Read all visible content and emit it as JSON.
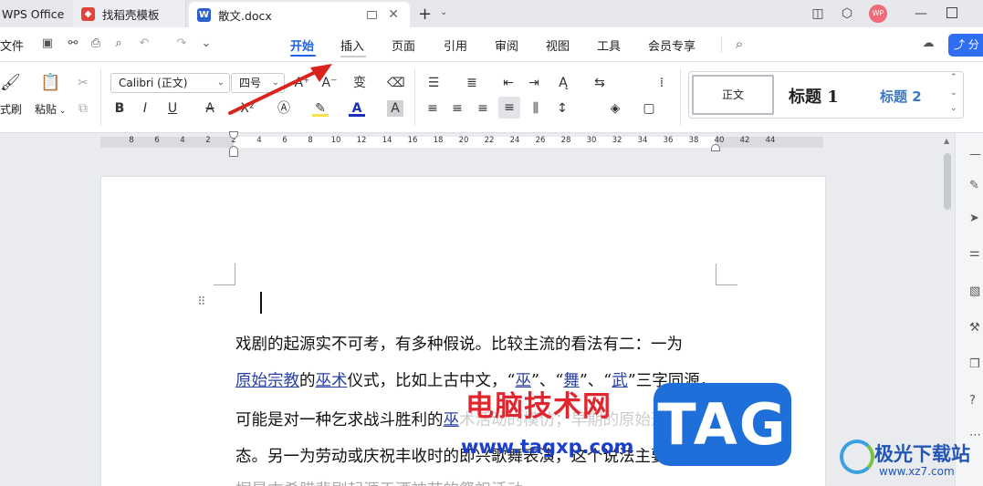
{
  "tabs": {
    "app": "WPS Office",
    "template": "找稻壳模板",
    "doc": "散文.docx"
  },
  "window": {
    "avatar": "WP"
  },
  "menu": {
    "file": "文件",
    "items": [
      "开始",
      "插入",
      "页面",
      "引用",
      "审阅",
      "视图",
      "工具",
      "会员专享"
    ],
    "share": "分"
  },
  "ribbon": {
    "format_painter": "式刷",
    "paste": "粘贴",
    "font_name": "Calibri (正文)",
    "font_size": "四号",
    "styles": {
      "normal": "正文",
      "h1": "标题 1",
      "h2": "标题 2"
    }
  },
  "ruler": {
    "ticks": [
      "8",
      "6",
      "4",
      "2",
      "2",
      "4",
      "6",
      "8",
      "10",
      "12",
      "14",
      "16",
      "18",
      "20",
      "22",
      "24",
      "26",
      "28",
      "30",
      "32",
      "34",
      "36",
      "38",
      "40",
      "42",
      "44"
    ]
  },
  "document": {
    "line1": "戏剧的起源实不可考，有多种假说。比较主流的看法有二：一为",
    "line2": {
      "l1": "原始宗教",
      "t1": "的",
      "l2": "巫术",
      "t2": "仪式，比如上古中文，“",
      "l3": "巫",
      "t3": "”、“",
      "l4": "舞",
      "t4": "”、“",
      "l5": "武",
      "t5": "”三字同源，"
    },
    "line3": {
      "t1": "可能是对一种乞求战斗胜利的",
      "l1": "巫",
      "t2": "术",
      "t3": "活动的模仿；早期的原始形"
    },
    "line4": "态。另一为劳动或庆祝丰收时的即兴歌舞表演，这个说法主要依",
    "line5": "据是古希腊悲剧起源于酒神节的祭祀活动"
  },
  "watermarks": {
    "site_cn": "电脑技术网",
    "site_url": "www.tagxp.com",
    "tag": "TAG",
    "brand": "极光下载站",
    "brand_url": "www.xz7.com"
  },
  "colors": {
    "accent": "#1f63e8",
    "link": "#2940a8",
    "watermark_red": "#e0262e",
    "tag_blue": "#1e6fd9"
  }
}
